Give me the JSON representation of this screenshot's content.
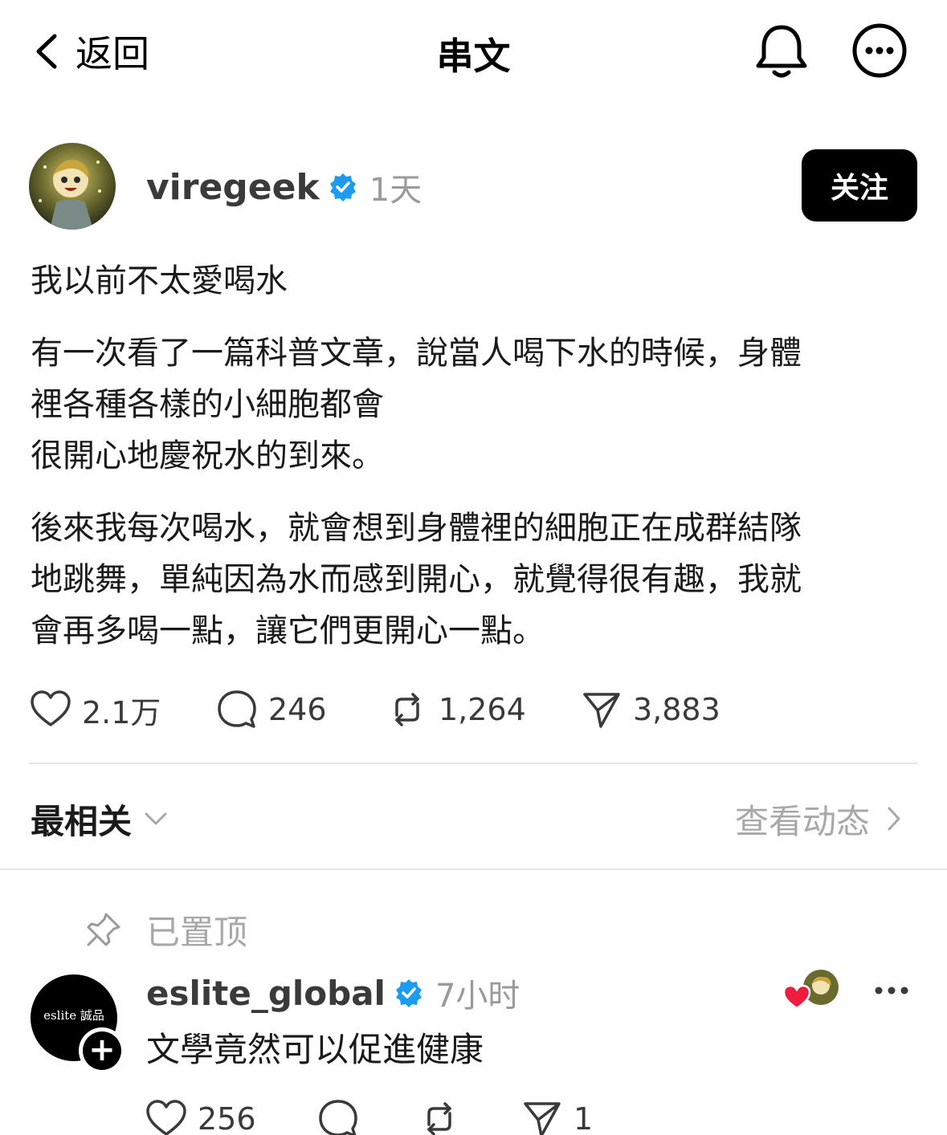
{
  "nav": {
    "back_label": "返回",
    "title": "串文"
  },
  "post": {
    "username": "viregeek",
    "time": "1天",
    "follow_label": "关注",
    "paragraphs": [
      "我以前不太愛喝水",
      "有一次看了一篇科普文章，說當人喝下水的時候，身體\n裡各種各樣的小細胞都會\n很開心地慶祝水的到來。",
      "後來我每次喝水，就會想到身體裡的細胞正在成群結隊\n地跳舞，單純因為水而感到開心，就覺得很有趣，我就\n會再多喝一點，讓它們更開心一點。"
    ],
    "stats": {
      "likes": "2.1万",
      "replies": "246",
      "reposts": "1,264",
      "shares": "3,883"
    }
  },
  "sort": {
    "label": "最相关",
    "activity_label": "查看动态"
  },
  "pinned": {
    "label": "已置顶"
  },
  "reply": {
    "avatar_logo": "eslite 誠品",
    "username": "eslite_global",
    "time": "7小时",
    "text": "文學竟然可以促進健康",
    "stats": {
      "likes": "256",
      "shares": "1"
    }
  },
  "colors": {
    "verified": "#1d9bf0",
    "follow_bg": "#000000",
    "muted_text": "#9a9a9a",
    "heart_red": "#ee1d3f"
  }
}
